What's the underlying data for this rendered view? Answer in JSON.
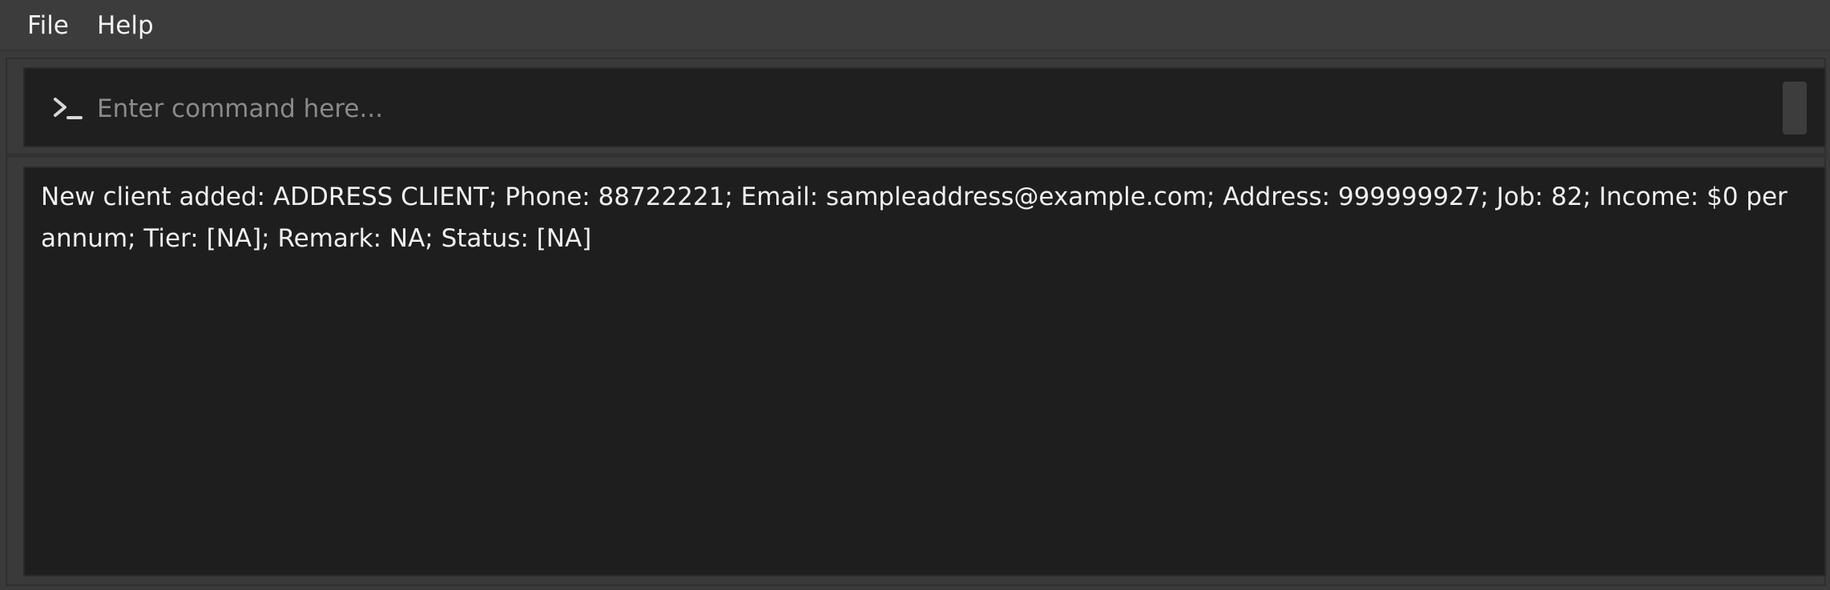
{
  "menubar": {
    "file_label": "File",
    "help_label": "Help"
  },
  "command": {
    "placeholder": "Enter command here...",
    "value": "",
    "icon": "terminal-prompt-icon"
  },
  "result": {
    "message": "New client added: ADDRESS CLIENT; Phone: 88722221; Email: sampleaddress@example.com; Address: 999999927; Job: 82; Income: $0 per annum; Tier: [NA]; Remark: NA; Status: [NA]"
  },
  "colors": {
    "menubar_bg": "#3c3c3c",
    "panel_bg": "#1e1e1e",
    "text": "#f0f0f0",
    "placeholder": "#8a8a8a"
  }
}
